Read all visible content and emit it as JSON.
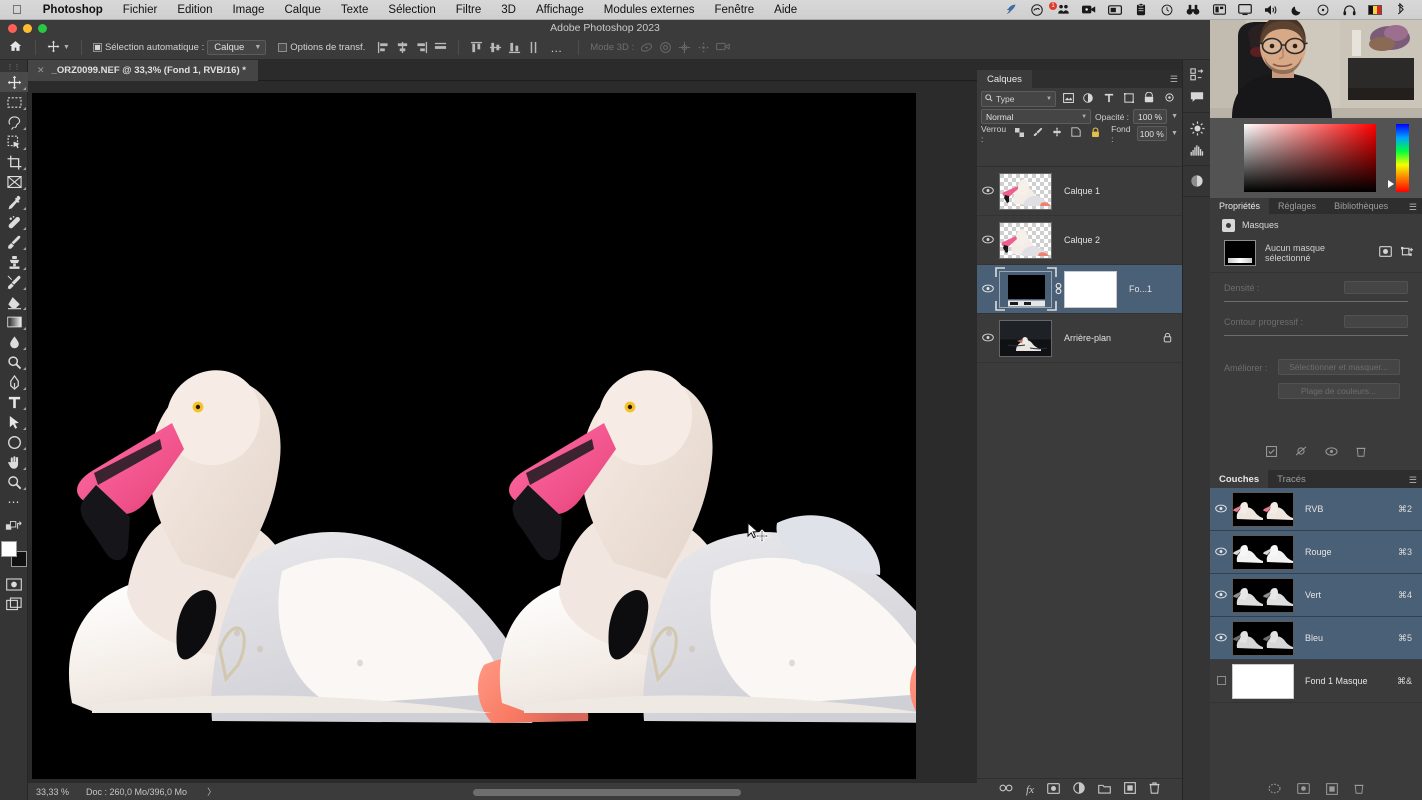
{
  "macbar": {
    "apple_icon": "apple-icon",
    "menus": [
      {
        "label": "Photoshop",
        "bold": true
      },
      {
        "label": "Fichier",
        "bold": false
      },
      {
        "label": "Edition",
        "bold": false
      },
      {
        "label": "Image",
        "bold": false
      },
      {
        "label": "Calque",
        "bold": false
      },
      {
        "label": "Texte",
        "bold": false
      },
      {
        "label": "Sélection",
        "bold": false
      },
      {
        "label": "Filtre",
        "bold": false
      },
      {
        "label": "3D",
        "bold": false
      },
      {
        "label": "Affichage",
        "bold": false
      },
      {
        "label": "Modules externes",
        "bold": false
      },
      {
        "label": "Fenêtre",
        "bold": false
      },
      {
        "label": "Aide",
        "bold": false
      }
    ],
    "status_icons": [
      "rocket-icon",
      "creative-cloud-icon",
      "people-icon",
      "screen-record-icon",
      "rectangle-icon",
      "clipboard-icon",
      "clock-icon",
      "binoculars-icon",
      "layout-icon",
      "display-icon",
      "volume-icon",
      "moon-icon",
      "timemachine-icon",
      "headphones-icon",
      "belgium-flag-icon",
      "bluetooth-icon"
    ],
    "notification_badge": "1"
  },
  "titlebar": {
    "title": "Adobe Photoshop 2023"
  },
  "optionsbar": {
    "home_icon": "home-icon",
    "tool_icon": "move-tool-icon",
    "auto_select_checkbox_label": "Sélection automatique :",
    "auto_select_value": "Calque",
    "transform_controls_label": "Options de transf.",
    "mode3d_label": "Mode 3D :",
    "more_options": "…",
    "align_icons": [
      "align-left-edges-icon",
      "align-horizontal-centers-icon",
      "align-right-edges-icon",
      "align-top-edges-icon",
      "align-vertical-centers-icon",
      "align-bottom-edges-icon",
      "distribute-left-icon",
      "distribute-center-icon",
      "distribute-right-icon",
      "distribute-edges-icon"
    ],
    "mode3d_icons": [
      "rotate-3d-icon",
      "roll-3d-icon",
      "pan-3d-icon",
      "slide-3d-icon",
      "camera-3d-icon"
    ]
  },
  "document_tab": {
    "close_icon": "close-icon",
    "title": "_ORZ0099.NEF @ 33,3% (Fond 1, RVB/16) *"
  },
  "toolbar": {
    "tools": [
      {
        "name": "move-tool",
        "active": true
      },
      {
        "name": "rectangular-marquee-tool",
        "active": false
      },
      {
        "name": "lasso-tool",
        "active": false
      },
      {
        "name": "object-selection-tool",
        "active": false
      },
      {
        "name": "crop-tool",
        "active": false
      },
      {
        "name": "frame-tool",
        "active": false
      },
      {
        "name": "eyedropper-tool",
        "active": false
      },
      {
        "name": "spot-healing-brush-tool",
        "active": false
      },
      {
        "name": "brush-tool",
        "active": false
      },
      {
        "name": "clone-stamp-tool",
        "active": false
      },
      {
        "name": "history-brush-tool",
        "active": false
      },
      {
        "name": "eraser-tool",
        "active": false
      },
      {
        "name": "gradient-tool",
        "active": false
      },
      {
        "name": "blur-tool",
        "active": false
      },
      {
        "name": "dodge-tool",
        "active": false
      },
      {
        "name": "pen-tool",
        "active": false
      },
      {
        "name": "type-tool",
        "active": false
      },
      {
        "name": "path-selection-tool",
        "active": false
      },
      {
        "name": "ellipse-tool",
        "active": false
      },
      {
        "name": "hand-tool",
        "active": false
      },
      {
        "name": "zoom-tool",
        "active": false
      },
      {
        "name": "edit-toolbar",
        "active": false
      }
    ],
    "quickmask_icon": "quick-mask-icon",
    "screenmode_icon": "screen-mode-icon",
    "swap_colors_icon": "swap-colors-icon",
    "default_colors_icon": "default-colors-icon",
    "foreground_color": "#ffffff",
    "background_color": "#111111"
  },
  "statusbar": {
    "zoom": "33,33 %",
    "doc_info": "Doc : 260,0 Mo/396,0 Mo",
    "arrow": "〉"
  },
  "dock": {
    "icons": [
      "history-icon",
      "comments-icon",
      "adjustments-icon",
      "histogram-icon",
      "color-wheel-icon"
    ]
  },
  "layers_panel": {
    "tabs": [
      {
        "label": "Calques",
        "active": true
      }
    ],
    "menu_icon": "panel-menu-icon",
    "filter_icon": "search-icon",
    "filter_value": "Type",
    "filter_type_icons": [
      "pixel-filter-icon",
      "adjustment-filter-icon",
      "type-filter-icon",
      "shape-filter-icon",
      "smartobject-filter-icon"
    ],
    "filter_toggle_icon": "filter-toggle-icon",
    "blend_mode": "Normal",
    "opacity_label": "Opacité :",
    "opacity_value": "100 %",
    "lock_label": "Verrou :",
    "lock_icons": [
      "lock-transparent-pixels-icon",
      "lock-image-pixels-icon",
      "lock-position-icon",
      "lock-artboard-icon",
      "lock-all-icon"
    ],
    "fill_label": "Fond :",
    "fill_value": "100 %",
    "rows": [
      {
        "name": "Calque 1",
        "visible": true,
        "selected": false,
        "locked": false,
        "thumb": "flamingo-transparent",
        "mask": false
      },
      {
        "name": "Calque 2",
        "visible": true,
        "selected": false,
        "locked": false,
        "thumb": "flamingo-transparent",
        "mask": false
      },
      {
        "name": "Fo...1",
        "visible": true,
        "selected": true,
        "locked": false,
        "thumb": "gradient-fill-black",
        "mask": true
      },
      {
        "name": "Arrière-plan",
        "visible": true,
        "selected": false,
        "locked": true,
        "thumb": "swan-photo",
        "mask": false
      }
    ],
    "footer_icons": [
      "link-layers-icon",
      "layer-style-fx-icon",
      "add-mask-icon",
      "adjustment-layer-icon",
      "new-group-icon",
      "new-layer-icon",
      "delete-layer-icon"
    ]
  },
  "properties_panel": {
    "tabs": [
      {
        "label": "Propriétés",
        "active": true
      },
      {
        "label": "Réglages",
        "active": false
      },
      {
        "label": "Bibliothèques",
        "active": false
      }
    ],
    "menu_icon": "panel-menu-icon",
    "section_title": "Masques",
    "mask_status": "Aucun masque sélectionné",
    "mask_action_icons": [
      "pixel-mask-icon",
      "vector-mask-icon"
    ],
    "density_label": "Densité :",
    "feather_label": "Contour progressif :",
    "improve_label": "Améliorer :",
    "select_and_mask_button": "Sélectionner et masquer...",
    "color_range_button": "Plage de couleurs...",
    "footer_icons": [
      "apply-mask-icon",
      "toggle-mask-icon",
      "show-mask-icon",
      "delete-mask-icon"
    ]
  },
  "channels_panel": {
    "tabs": [
      {
        "label": "Couches",
        "active": true
      },
      {
        "label": "Tracés",
        "active": false
      }
    ],
    "menu_icon": "panel-menu-icon",
    "rows": [
      {
        "name": "RVB",
        "shortcut": "⌘2",
        "visible": true,
        "selected": true,
        "thumb": "flamingos-composite"
      },
      {
        "name": "Rouge",
        "shortcut": "⌘3",
        "visible": true,
        "selected": true,
        "thumb": "flamingos-red"
      },
      {
        "name": "Vert",
        "shortcut": "⌘4",
        "visible": true,
        "selected": true,
        "thumb": "flamingos-green"
      },
      {
        "name": "Bleu",
        "shortcut": "⌘5",
        "visible": true,
        "selected": true,
        "thumb": "flamingos-blue"
      },
      {
        "name": "Fond 1 Masque",
        "shortcut": "⌘&",
        "visible": false,
        "selected": false,
        "thumb": "white-mask"
      }
    ],
    "footer_icons": [
      "load-selection-icon",
      "save-selection-icon",
      "new-channel-icon",
      "delete-channel-icon"
    ]
  },
  "color_panel": {
    "gradient_from": "#ffffff",
    "gradient_to": "#ff0000",
    "hue_marker": "hue-marker-icon"
  },
  "canvas": {
    "background_color": "#000000",
    "cursor_icon": "move-cursor-icon",
    "subject": "two-flamingos-on-black"
  }
}
